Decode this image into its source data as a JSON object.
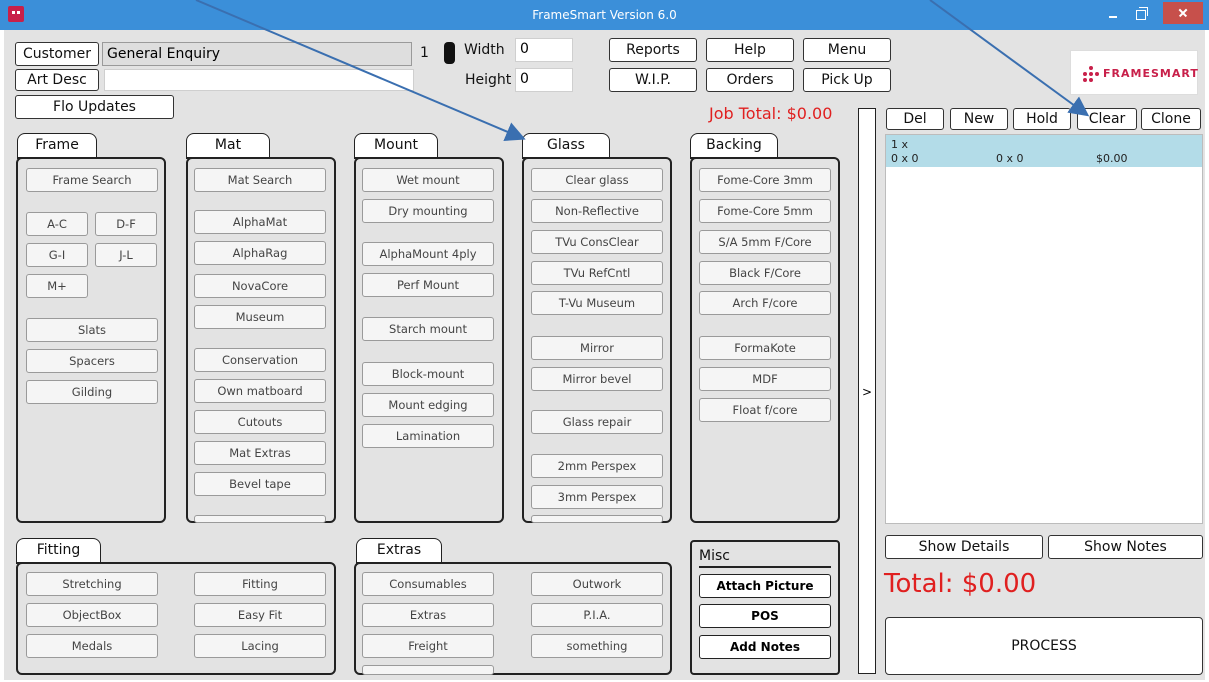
{
  "window": {
    "title": "FrameSmart Version 6.0"
  },
  "header": {
    "customer_label": "Customer",
    "customer_value": "General Enquiry",
    "spinner_value": "1",
    "art_desc_label": "Art Desc",
    "art_desc_value": "",
    "flo_updates": "Flo Updates",
    "width_label": "Width",
    "width_value": "0",
    "height_label": "Height",
    "height_value": "0",
    "reports": "Reports",
    "help": "Help",
    "menu": "Menu",
    "wip": "W.I.P.",
    "orders": "Orders",
    "pickup": "Pick Up",
    "job_total": "Job Total: $0.00",
    "logo_text": "FRAMESMART"
  },
  "order_actions": {
    "del": "Del",
    "new": "New",
    "hold": "Hold",
    "clear": "Clear",
    "clone": "Clone",
    "expand": ">"
  },
  "order_list": {
    "rows": [
      {
        "qty": "1 x",
        "size1": "0 x 0",
        "size2": "0 x 0",
        "price": "$0.00"
      }
    ]
  },
  "panels": {
    "frame": {
      "tab": "Frame",
      "items": [
        "Frame Search",
        "A-C",
        "D-F",
        "G-I",
        "J-L",
        "M+",
        "Slats",
        "Spacers",
        "Gilding"
      ]
    },
    "mat": {
      "tab": "Mat",
      "items": [
        "Mat Search",
        "AlphaMat",
        "AlphaRag",
        "NovaCore",
        "Museum",
        "Conservation",
        "Own matboard",
        "Cutouts",
        "Mat Extras",
        "Bevel tape"
      ]
    },
    "mount": {
      "tab": "Mount",
      "items": [
        "Wet mount",
        "Dry mounting",
        "AlphaMount 4ply",
        "Perf Mount",
        "Starch mount",
        "Block-mount",
        "Mount edging",
        "Lamination"
      ]
    },
    "glass": {
      "tab": "Glass",
      "items": [
        "Clear glass",
        "Non-Reflective",
        "TVu ConsClear",
        "TVu RefCntl",
        "T-Vu Museum",
        "Mirror",
        "Mirror bevel",
        "Glass repair",
        "2mm Perspex",
        "3mm Perspex"
      ]
    },
    "backing": {
      "tab": "Backing",
      "items": [
        "Fome-Core 3mm",
        "Fome-Core 5mm",
        "S/A 5mm F/Core",
        "Black F/Core",
        "Arch F/core",
        "FormaKote",
        "MDF",
        "Float f/core"
      ]
    },
    "fitting": {
      "tab": "Fitting",
      "items": [
        "Stretching",
        "Fitting",
        "ObjectBox",
        "Easy Fit",
        "Medals",
        "Lacing"
      ]
    },
    "extras": {
      "tab": "Extras",
      "items": [
        "Consumables",
        "Outwork",
        "Extras",
        "P.I.A.",
        "Freight",
        "something"
      ]
    },
    "misc": {
      "title": "Misc",
      "items": [
        "Attach Picture",
        "POS",
        "Add Notes"
      ]
    }
  },
  "right": {
    "show_details": "Show Details",
    "show_notes": "Show Notes",
    "total": "Total: $0.00",
    "process": "PROCESS"
  },
  "colors": {
    "titlebar": "#3b8fd9",
    "total_red": "#e02020",
    "list_row": "#b3dce8",
    "arrow": "#3a6fb0"
  }
}
